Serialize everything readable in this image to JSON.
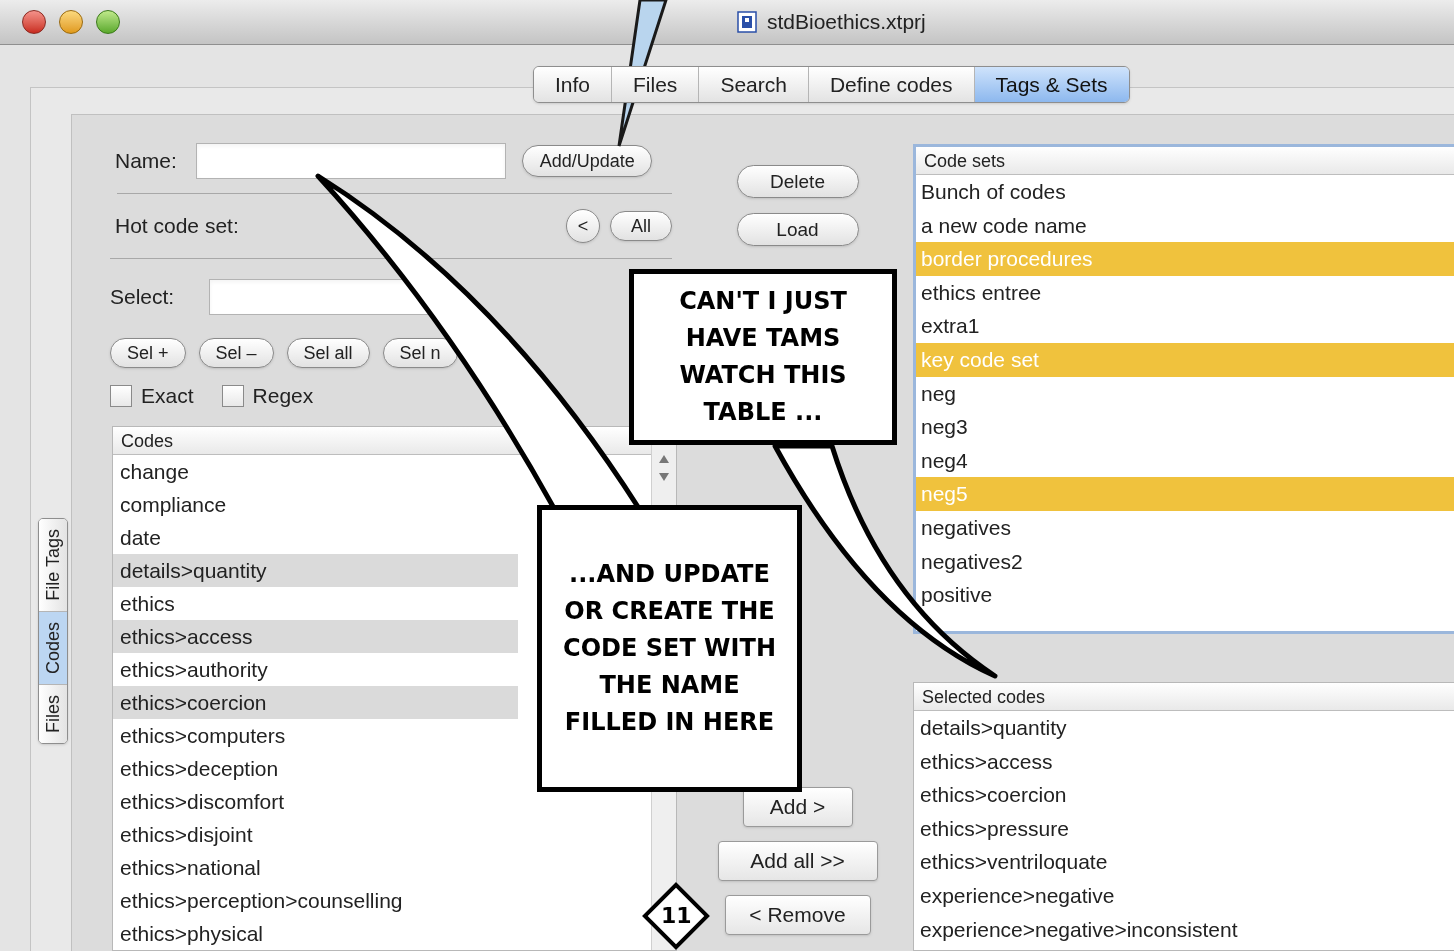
{
  "window": {
    "title": "stdBioethics.xtprj"
  },
  "tabs": [
    {
      "label": "Info",
      "selected": false
    },
    {
      "label": "Files",
      "selected": false
    },
    {
      "label": "Search",
      "selected": false
    },
    {
      "label": "Define codes",
      "selected": false
    },
    {
      "label": "Tags & Sets",
      "selected": true
    }
  ],
  "side_tabs": [
    {
      "label": "File Tags",
      "selected": false
    },
    {
      "label": "Codes",
      "selected": true
    },
    {
      "label": "Files",
      "selected": false
    }
  ],
  "name_field": {
    "label": "Name:",
    "button": "Add/Update"
  },
  "hot_code_set": {
    "label": "Hot code set:",
    "buttons": [
      "<",
      "All"
    ]
  },
  "select_field": {
    "label": "Select:"
  },
  "select_buttons": [
    "Sel +",
    "Sel –",
    "Sel all",
    "Sel n"
  ],
  "options": [
    {
      "label": "Exact",
      "checked": false
    },
    {
      "label": "Regex",
      "checked": false
    }
  ],
  "codes": {
    "header": "Codes",
    "rows": [
      {
        "text": "change",
        "selected": false
      },
      {
        "text": "compliance",
        "selected": false
      },
      {
        "text": "date",
        "selected": false
      },
      {
        "text": "details>quantity",
        "selected": true
      },
      {
        "text": "ethics",
        "selected": false
      },
      {
        "text": "ethics>access",
        "selected": true
      },
      {
        "text": "ethics>authority",
        "selected": false
      },
      {
        "text": "ethics>coercion",
        "selected": true
      },
      {
        "text": "ethics>computers",
        "selected": false
      },
      {
        "text": "ethics>deception",
        "selected": false
      },
      {
        "text": "ethics>discomfort",
        "selected": false
      },
      {
        "text": "ethics>disjoint",
        "selected": false
      },
      {
        "text": "ethics>national",
        "selected": false
      },
      {
        "text": "ethics>perception>counselling",
        "selected": false
      },
      {
        "text": "ethics>physical",
        "selected": false
      }
    ]
  },
  "set_buttons": [
    "Delete",
    "Load"
  ],
  "move_buttons": [
    "Add >",
    "Add all >>",
    "< Remove"
  ],
  "code_sets": {
    "header": "Code sets",
    "rows": [
      {
        "text": "Bunch of codes",
        "selected": false
      },
      {
        "text": "a new code name",
        "selected": false
      },
      {
        "text": "border procedures",
        "selected": true
      },
      {
        "text": "ethics entree",
        "selected": false
      },
      {
        "text": "extra1",
        "selected": false
      },
      {
        "text": "key code set",
        "selected": true
      },
      {
        "text": "neg",
        "selected": false
      },
      {
        "text": "neg3",
        "selected": false
      },
      {
        "text": "neg4",
        "selected": false
      },
      {
        "text": "neg5",
        "selected": true
      },
      {
        "text": "negatives",
        "selected": false
      },
      {
        "text": "negatives2",
        "selected": false
      },
      {
        "text": "positive",
        "selected": false
      }
    ]
  },
  "selected_codes": {
    "header": "Selected codes",
    "rows": [
      "details>quantity",
      "ethics>access",
      "ethics>coercion",
      "ethics>pressure",
      "ethics>ventriloquate",
      "experience>negative",
      "experience>negative>inconsistent"
    ]
  },
  "comic": {
    "balloons": [
      {
        "text": "CAN'T I JUST HAVE TAMS WATCH THIS TABLE ..."
      },
      {
        "text": "...AND UPDATE OR CREATE THE CODE SET WITH THE NAME FILLED IN HERE"
      }
    ],
    "panel_number": "11"
  }
}
